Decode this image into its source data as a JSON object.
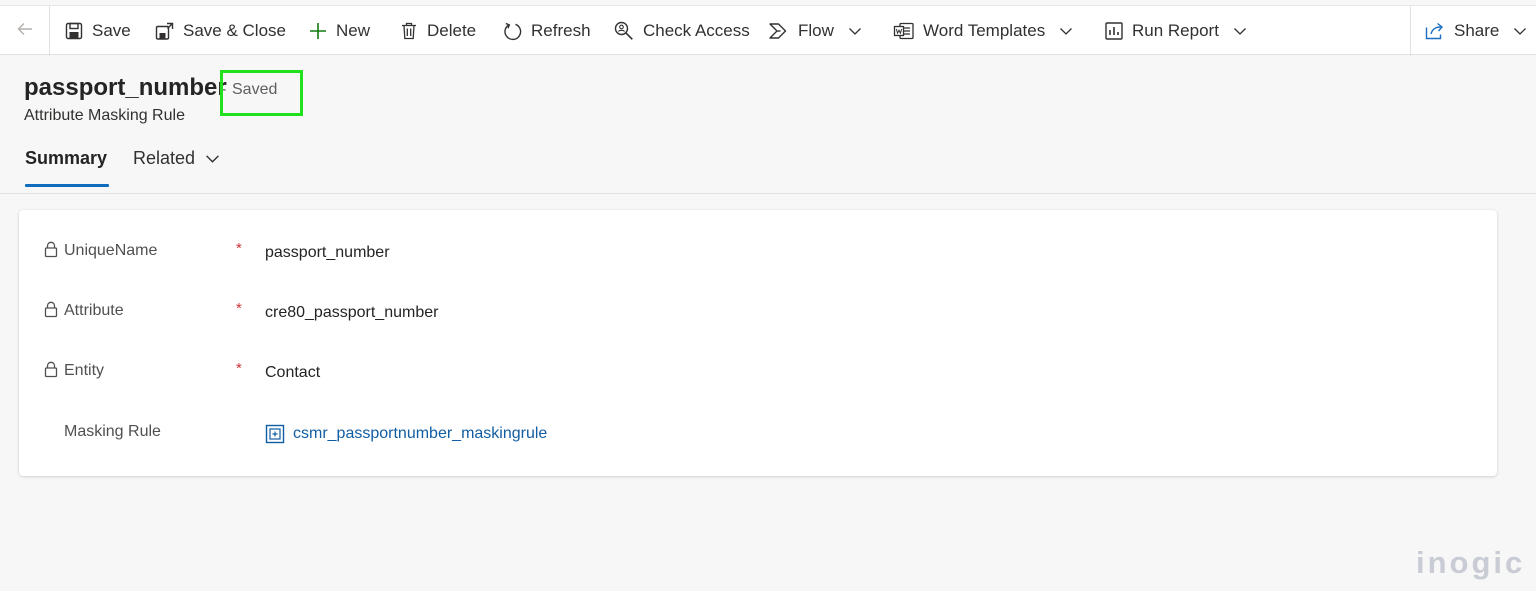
{
  "toolbar": {
    "back_icon": "back-arrow-icon",
    "save": "Save",
    "save_close": "Save & Close",
    "new": "New",
    "delete": "Delete",
    "refresh": "Refresh",
    "check_access": "Check Access",
    "flow": "Flow",
    "word_templates": "Word Templates",
    "run_report": "Run Report",
    "share": "Share"
  },
  "record": {
    "title": "passport_number",
    "separator": "-",
    "save_status": "Saved",
    "entity_type": "Attribute Masking Rule",
    "highlight_color": "#22e01c"
  },
  "tabs": [
    {
      "label": "Summary",
      "active": true
    },
    {
      "label": "Related",
      "active": false
    }
  ],
  "form": {
    "fields": [
      {
        "label": "UniqueName",
        "value": "passport_number",
        "required": true,
        "locked": true
      },
      {
        "label": "Attribute",
        "value": "cre80_passport_number",
        "required": true,
        "locked": true
      },
      {
        "label": "Entity",
        "value": "Contact",
        "required": true,
        "locked": true
      },
      {
        "label": "Masking Rule",
        "value": "csmr_passportnumber_maskingrule",
        "required": false,
        "locked": false,
        "is_lookup": true
      }
    ],
    "required_marker": "*"
  },
  "watermark": "inogic",
  "colors": {
    "accent": "#0f6cbd",
    "link": "#115ea3",
    "required": "#d13438"
  }
}
